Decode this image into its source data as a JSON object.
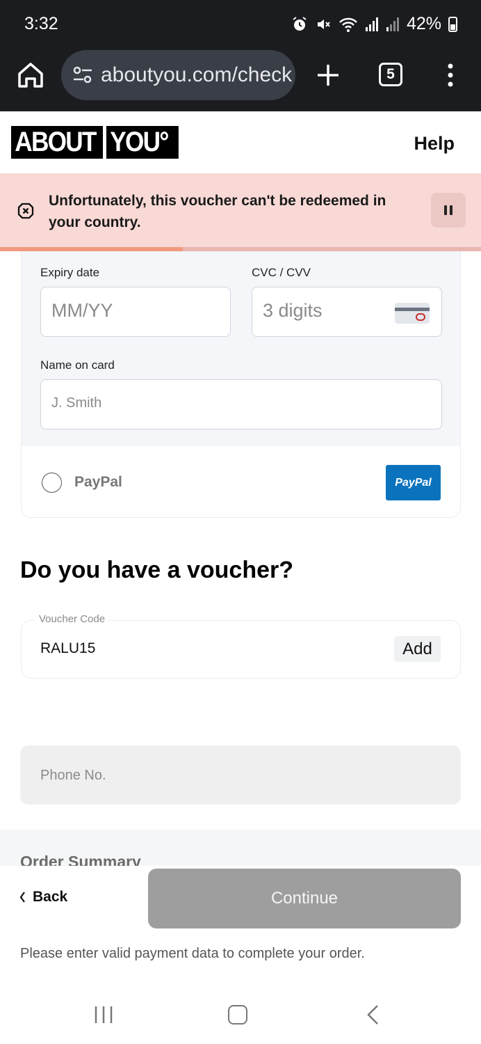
{
  "status_bar": {
    "time": "3:32",
    "battery": "42%",
    "icons": [
      "alarm-icon",
      "mute-icon",
      "wifi-icon",
      "signal-icon",
      "signal-icon",
      "battery-icon"
    ]
  },
  "browser": {
    "url": "aboutyou.com/check",
    "tab_count": "5"
  },
  "site_header": {
    "logo_part1": "ABOUT",
    "logo_part2": "YOU°",
    "help_label": "Help"
  },
  "alert": {
    "message": "Unfortunately, this voucher can't be redeemed in your country.",
    "progress": 0.38,
    "colors": {
      "background": "#f8d9d5",
      "progress": "#f29a7f"
    }
  },
  "card_form": {
    "expiry_label": "Expiry date",
    "expiry_placeholder": "MM/YY",
    "cvc_label": "CVC / CVV",
    "cvc_placeholder": "3 digits",
    "name_label": "Name on card",
    "name_placeholder": "J. Smith"
  },
  "payment_options": {
    "paypal_label": "PayPal",
    "paypal_logo_text": "PayPal",
    "paypal_selected": false
  },
  "voucher": {
    "title": "Do you have a voucher?",
    "field_label": "Voucher Code",
    "value": "RALU15",
    "add_label": "Add"
  },
  "phone": {
    "placeholder": "Phone No."
  },
  "order_summary": {
    "title": "Order Summary"
  },
  "footer": {
    "back_label": "Back",
    "continue_label": "Continue",
    "hint": "Please enter valid payment data to complete your order."
  }
}
